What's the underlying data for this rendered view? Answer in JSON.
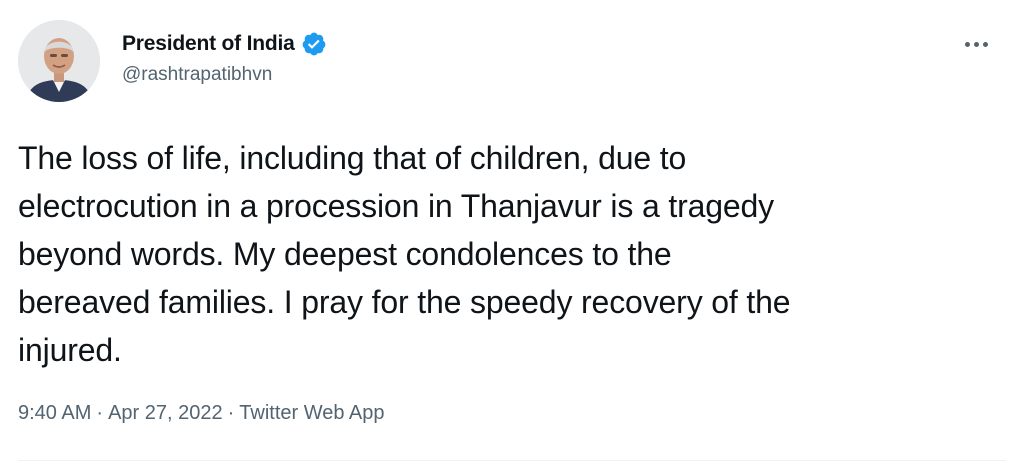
{
  "author": {
    "name": "President of India",
    "handle": "@rashtrapatibhvn",
    "verified": true,
    "avatar_icon": "profile-photo",
    "verified_icon": "verified-badge-icon"
  },
  "tweet": {
    "text": "The loss of life, including that of children, due to\nelectrocution in a procession in Thanjavur is a tragedy\nbeyond words. My deepest condolences to the\nbereaved families. I pray for the speedy recovery of the\ninjured.",
    "time": "9:40 AM",
    "date": "Apr 27, 2022",
    "source": "Twitter Web App",
    "separator": "·"
  },
  "colors": {
    "text_primary": "#0f1419",
    "text_secondary": "#536471",
    "verified_blue": "#1d9bf0",
    "divider": "#eff3f4"
  }
}
